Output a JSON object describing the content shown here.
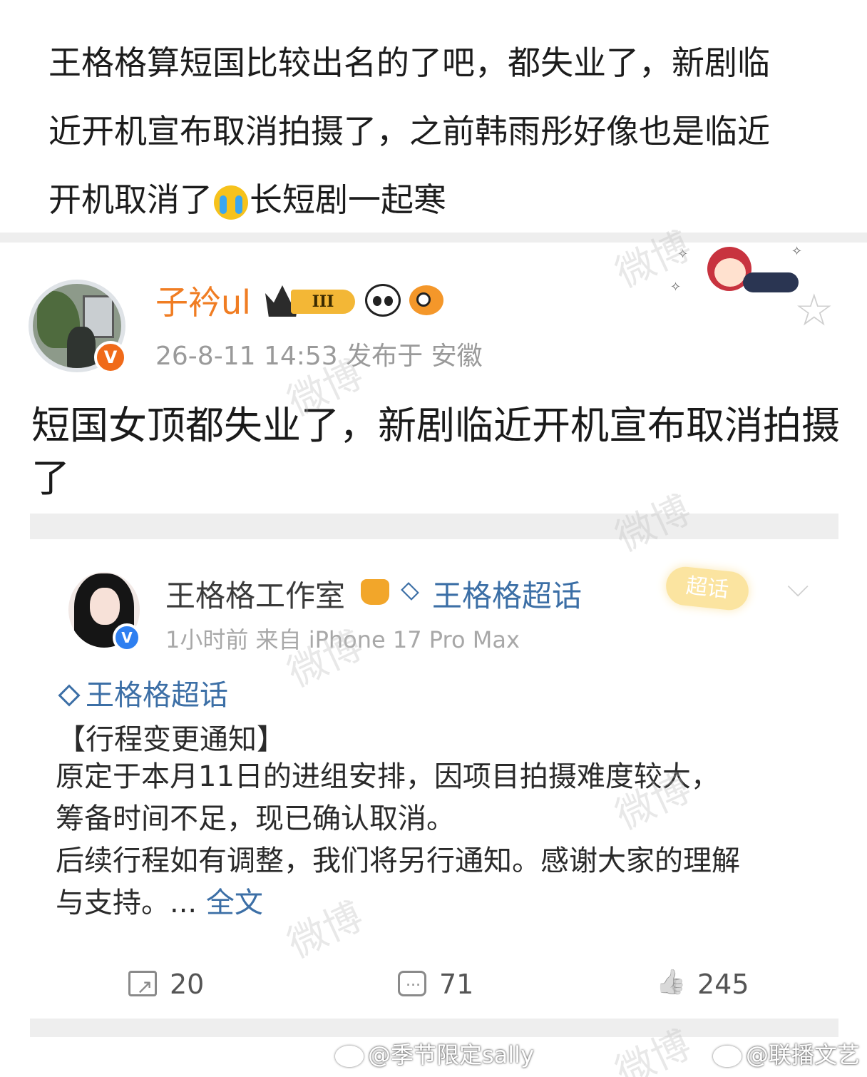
{
  "caption": {
    "line1": "王格格算短国比较出名的了吧，都失业了，新剧临",
    "line2": "近开机宣布取消拍摄了，之前韩雨彤好像也是临近",
    "line3_a": "开机取消了",
    "line3_b": "长短剧一起寒",
    "emoji_icon": "crying-face-icon"
  },
  "post": {
    "username": "子衿ul",
    "level_badge": "III",
    "verified_badge": "V",
    "meta": "26-8-11 14:53  发布于 安徽",
    "text": "短国女顶都失业了，新剧临近开机宣布取消拍摄了"
  },
  "quoted": {
    "username": "王格格工作室",
    "supertopic_link": "王格格超话",
    "chaohua_button": "超话",
    "verified_badge": "V",
    "meta": "1小时前  来自 iPhone 17 Pro Max",
    "topic_tag": "王格格超话",
    "notice_title": "【行程变更通知】",
    "body_line1": "原定于本月11日的进组安排，因项目拍摄难度较大，",
    "body_line2": "筹备时间不足，现已确认取消。",
    "body_line3": "后续行程如有调整，我们将另行通知。感谢大家的理解",
    "body_line4": "与支持。... ",
    "full_text_link": "全文",
    "share_count": "20",
    "comment_count": "71",
    "like_count": "245"
  },
  "watermark": "微博",
  "credits": {
    "left": "@季节限定sally",
    "right": "@联播文艺"
  },
  "colors": {
    "username_orange": "#f07d23",
    "link_blue": "#3c6fa6",
    "meta_gray": "#9a9a9a",
    "divider_gray": "#eeeeee"
  }
}
